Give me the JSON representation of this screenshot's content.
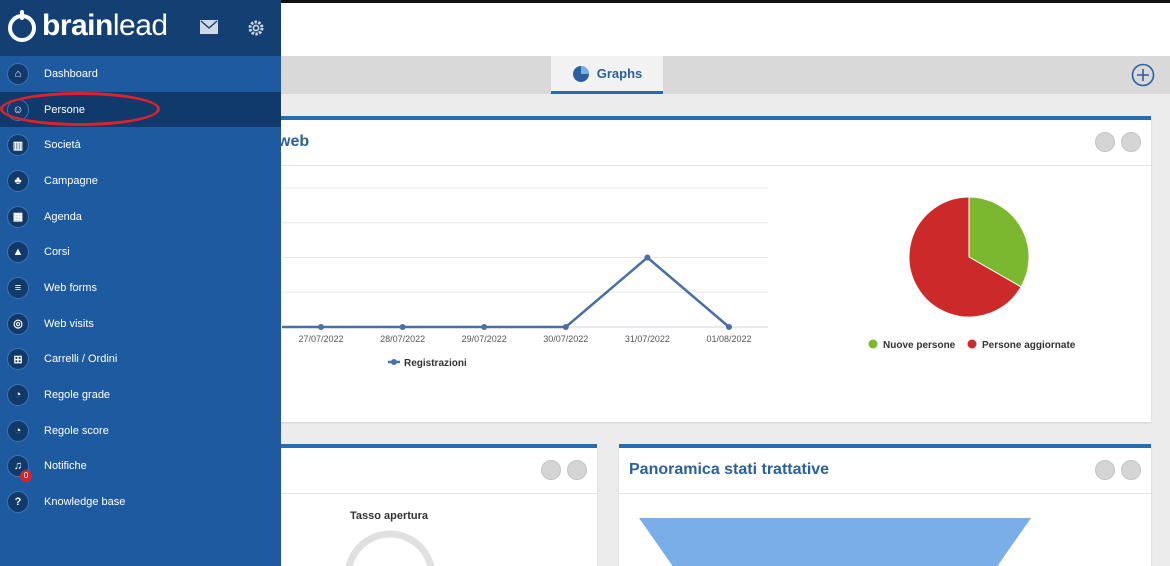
{
  "brand": {
    "name_bold": "brain",
    "name_light": "lead"
  },
  "sidebar": {
    "items": [
      {
        "label": "Dashboard",
        "icon": "home-icon"
      },
      {
        "label": "Persone",
        "icon": "person-icon",
        "active": true
      },
      {
        "label": "Società",
        "icon": "building-icon"
      },
      {
        "label": "Campagne",
        "icon": "campaign-icon"
      },
      {
        "label": "Agenda",
        "icon": "calendar-icon"
      },
      {
        "label": "Corsi",
        "icon": "graduation-icon"
      },
      {
        "label": "Web forms",
        "icon": "list-icon"
      },
      {
        "label": "Web visits",
        "icon": "globe-icon"
      },
      {
        "label": "Carrelli / Ordini",
        "icon": "cart-icon"
      },
      {
        "label": "Regole grade",
        "icon": "gauge-icon"
      },
      {
        "label": "Regole score",
        "icon": "gauge-icon"
      },
      {
        "label": "Notifiche",
        "icon": "bell-icon",
        "badge": "0"
      },
      {
        "label": "Knowledge base",
        "icon": "question-icon"
      }
    ]
  },
  "tabs": {
    "graphs_label": "Graphs"
  },
  "panels": {
    "registrations_title_fragment": "web",
    "open_rate_title": "Tasso apertura",
    "pipeline_title": "Panoramica stati trattative"
  },
  "colors": {
    "sidebar": "#1e5aa0",
    "brand_bar": "#143f73",
    "accent": "#2c5f9e",
    "line_series": "#4a6fa5",
    "pie_green": "#7cb82f",
    "pie_red": "#cc2a2a",
    "funnel": "#7aaee8",
    "annotation": "#e3202a"
  },
  "chart_data": [
    {
      "type": "line",
      "x": [
        "27/07/2022",
        "28/07/2022",
        "29/07/2022",
        "30/07/2022",
        "31/07/2022",
        "01/08/2022"
      ],
      "series": [
        {
          "name": "Registrazioni",
          "values": [
            0,
            0,
            0,
            0,
            1,
            0
          ]
        }
      ],
      "ylim": [
        0,
        2
      ],
      "grid": true,
      "legend": "bottom"
    },
    {
      "type": "pie",
      "slices": [
        {
          "name": "Nuove persone",
          "value": 33.3
        },
        {
          "name": "Persone aggiornate",
          "value": 66.7
        }
      ],
      "legend": "bottom"
    }
  ]
}
